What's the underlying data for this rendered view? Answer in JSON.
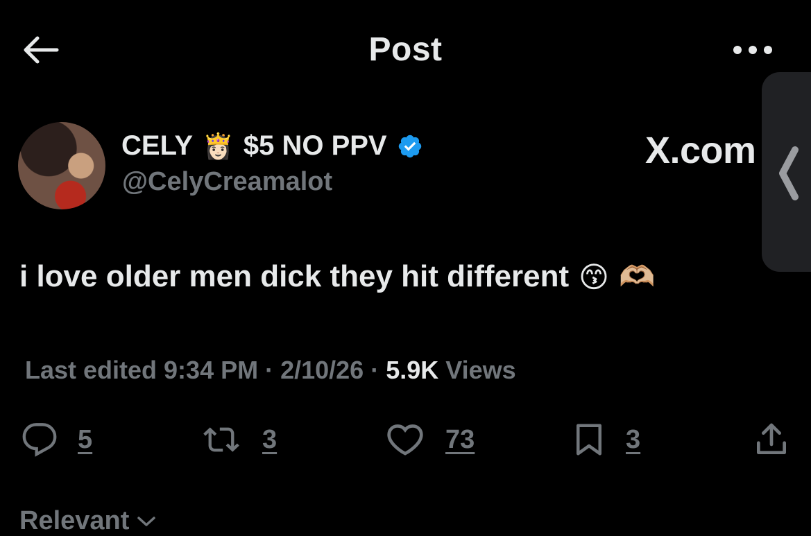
{
  "header": {
    "title": "Post"
  },
  "icons": {
    "back": "back-arrow-icon",
    "more": "more-dots-icon",
    "verified": "verified-badge-icon",
    "handle_chevron": "chevron-left-icon"
  },
  "author": {
    "display_name": "CELY",
    "crown": "👸🏻",
    "tagline": "$5 NO PPV",
    "handle": "@CelyCreamalot"
  },
  "watermark": "X.com",
  "post": {
    "text": "i love older men dick they hit different",
    "emoji_1": "😙",
    "emoji_2": "🫶🏼"
  },
  "meta": {
    "edited_label": "Last edited 9:34 PM · 2/10/26 · ",
    "views_count": "5.9K",
    "views_label": " Views"
  },
  "actions": {
    "replies": "5",
    "reposts": "3",
    "likes": "73",
    "bookmarks": "3"
  },
  "sort": {
    "label": "Relevant"
  },
  "colors": {
    "background": "#000000",
    "text": "#e7e9ea",
    "muted": "#71767b",
    "verified": "#1d9bf0"
  }
}
